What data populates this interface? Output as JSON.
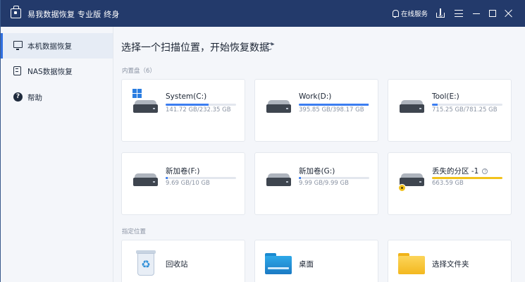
{
  "window": {
    "title": "易我数据恢复 专业版 终身",
    "service_label": "在线服务"
  },
  "sidebar": {
    "items": [
      {
        "label": "本机数据恢复",
        "icon": "computer-icon",
        "active": true
      },
      {
        "label": "NAS数据恢复",
        "icon": "nas-icon",
        "active": false
      },
      {
        "label": "帮助",
        "icon": "help-icon",
        "active": false
      }
    ]
  },
  "main": {
    "title": "选择一个扫描位置，开始恢复数据",
    "drives_section_label": "内置盘（6）",
    "locations_section_label": "指定位置",
    "drives": [
      {
        "name": "System(C:)",
        "size": "141.72 GB/232.35 GB",
        "used_fraction": 0.61,
        "badge": "windows-icon"
      },
      {
        "name": "Work(D:)",
        "size": "395.85 GB/398.17 GB",
        "used_fraction": 0.99,
        "badge": ""
      },
      {
        "name": "Tool(E:)",
        "size": "715.25 GB/781.25 GB",
        "used_fraction": 0.08,
        "badge": ""
      },
      {
        "name": "新加卷(F:)",
        "size": "9.69 GB/10 GB",
        "used_fraction": 0.03,
        "badge": ""
      },
      {
        "name": "新加卷(G:)",
        "size": "9.99 GB/9.99 GB",
        "used_fraction": 0.03,
        "badge": ""
      },
      {
        "name": "丢失的分区 -1",
        "size": "663.59 GB",
        "used_fraction": 1.0,
        "badge": "warning-icon",
        "bar_color": "#f2c21c"
      }
    ],
    "locations": [
      {
        "name": "回收站",
        "icon": "recycle-bin-icon"
      },
      {
        "name": "桌面",
        "icon": "desktop-folder-icon"
      },
      {
        "name": "选择文件夹",
        "icon": "folder-icon"
      }
    ]
  },
  "colors": {
    "titlebar": "#233a6b",
    "accent": "#2f6fe0",
    "progress": "#3c7ef0",
    "warning": "#f2c21c"
  }
}
